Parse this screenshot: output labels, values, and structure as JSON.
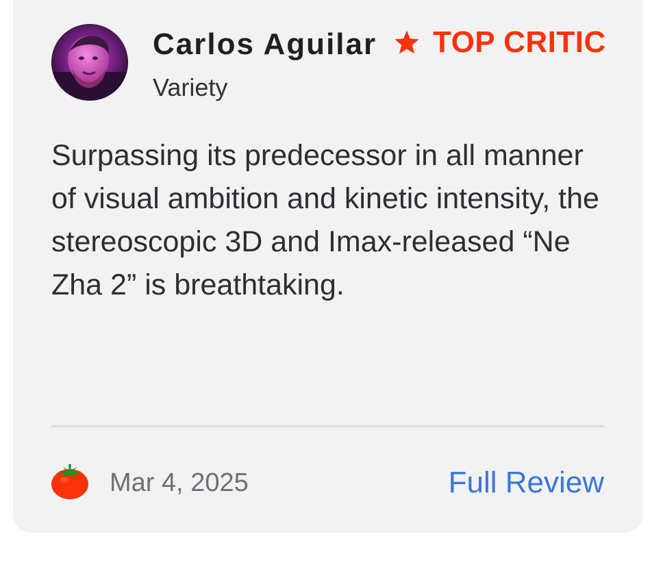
{
  "review": {
    "critic_name": "Carlos Aguilar",
    "badge_label": "TOP CRITIC",
    "publication": "Variety",
    "quote": "Surpassing its predecessor in all manner of visual ambition and kinetic intensity, the stereoscopic 3D and Imax-released “Ne Zha 2” is breathtaking.",
    "date": "Mar 4, 2025",
    "full_review_label": "Full Review",
    "score_icon": "fresh-tomato-icon"
  },
  "colors": {
    "card_background": "#f2f2f2",
    "badge": "#fa320a",
    "link": "#3976dc",
    "divider": "#dcdcdc",
    "text_primary": "#1d1f23",
    "text_muted": "#6b6f76"
  }
}
